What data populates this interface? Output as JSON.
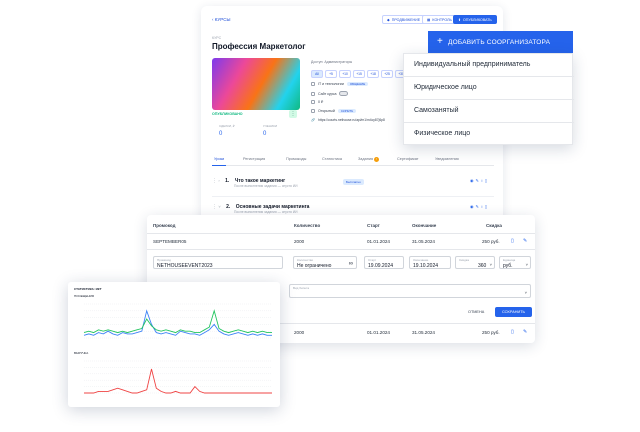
{
  "course": {
    "back": "КУРСЫ",
    "toolbar": [
      {
        "label": "ПРОДВИЖЕНИЕ"
      },
      {
        "label": "КОНТРОЛЬ"
      },
      {
        "label": "ОПУБЛИКОВАТЬ"
      }
    ],
    "crumb": "КУРС",
    "title": "Профессия Маркетолог",
    "status": "ОПУБЛИКОВАНО",
    "stats": [
      {
        "label": "СДЕЛКИ, ₽",
        "value": "0"
      },
      {
        "label": "УЧЕНИКИ",
        "value": "0"
      }
    ],
    "access_label": "Доступ: Администраторы",
    "chips": [
      "All",
      "+5",
      "+10",
      "+15",
      "+18",
      "+25",
      "+30"
    ],
    "options": [
      {
        "label": "IT и технологии",
        "tag": "ОБЩЕНИЕ"
      },
      {
        "label": "Сайт курса",
        "tag": ""
      },
      {
        "label": "0 ₽",
        "tag": ""
      },
      {
        "label": "Открытый",
        "tag": "СКРЫТЬ"
      }
    ],
    "url": "https://courts.nethouse.ru/api/m1/m4cy87j6p8",
    "tabs": [
      "Уроки",
      "Регистрация",
      "Промокоды",
      "Статистика",
      "Задания",
      "Сертификат",
      "Уведомления"
    ],
    "tasks_badge": "!",
    "lessons": [
      {
        "num": "1.",
        "title": "Что такое маркетинг",
        "sub": "После выполнения задания — спустя ИИ",
        "badge": "Бесплатно"
      },
      {
        "num": "2.",
        "title": "Основные задачи маркетинга",
        "sub": "После выполнения задания — спустя ИИ",
        "badge": ""
      }
    ]
  },
  "dropdown": {
    "button": "ДОБАВИТЬ СООРГАНИЗАТОРА",
    "items": [
      "Индивидуальный предприниматель",
      "Юридическое лицо",
      "Самозанятый",
      "Физическое лицо"
    ]
  },
  "promo": {
    "headers": [
      "Промокод",
      "Количество",
      "Старт",
      "Окончание",
      "Скидка"
    ],
    "rows": [
      {
        "code": "SEPTEMBER05",
        "qty": "2000",
        "start": "01.01.2024",
        "end": "31.05.2024",
        "discount": "250 руб."
      },
      {
        "code": "",
        "qty": "2000",
        "start": "01.01.2024",
        "end": "31.05.2024",
        "discount": "250 руб."
      }
    ],
    "form": {
      "code_label": "Промокод",
      "code_value": "NETHOUSEEVENT2023",
      "qty_label": "Количество",
      "qty_value": "Не ограничено",
      "start_label": "Старт",
      "start_value": "19.09.2024",
      "end_label": "Окончание",
      "end_value": "19.10.2024",
      "disc_label": "Скидка",
      "disc_value": "360",
      "unit_label": "Единица",
      "unit_value": "руб.",
      "type_label": "Вид билета",
      "cancel": "ОТМЕНА",
      "save": "СОХРАНИТЬ"
    }
  },
  "charts": {
    "title": "СТАТИСТИКА: ИКТ",
    "chart1_label": "ПОСЕЩЕНИЯ",
    "chart2_label": "ВЫРУЧКА",
    "colors": {
      "blue": "#3b82f6",
      "green": "#22c55e",
      "red": "#ef4444"
    }
  },
  "chart_data": [
    {
      "type": "line",
      "series": [
        {
          "values": [
            2,
            3,
            2,
            4,
            3,
            5,
            3,
            2,
            4,
            3,
            3,
            4,
            5,
            20,
            10,
            4,
            3,
            4,
            3,
            2,
            5,
            4,
            3,
            3,
            2,
            4,
            6,
            10,
            5,
            3,
            2,
            3,
            4,
            3,
            2,
            3,
            2,
            3,
            2,
            2
          ]
        },
        {
          "values": [
            4,
            5,
            4,
            6,
            5,
            6,
            5,
            4,
            5,
            4,
            5,
            6,
            7,
            14,
            9,
            6,
            5,
            6,
            5,
            4,
            6,
            5,
            5,
            4,
            4,
            6,
            8,
            20,
            7,
            5,
            4,
            5,
            6,
            5,
            4,
            5,
            4,
            5,
            4,
            4
          ]
        }
      ],
      "ylim": [
        0,
        25
      ]
    },
    {
      "type": "line",
      "series": [
        {
          "values": [
            0,
            0,
            0,
            1,
            1,
            1,
            2,
            3,
            2,
            1,
            0,
            0,
            1,
            2,
            15,
            3,
            1,
            0,
            0,
            1,
            0,
            0,
            0,
            4,
            1,
            0,
            0,
            0,
            0,
            0,
            0,
            0,
            0,
            0,
            0,
            0,
            0,
            0,
            0,
            0
          ]
        }
      ],
      "ylim": [
        0,
        20
      ]
    }
  ]
}
